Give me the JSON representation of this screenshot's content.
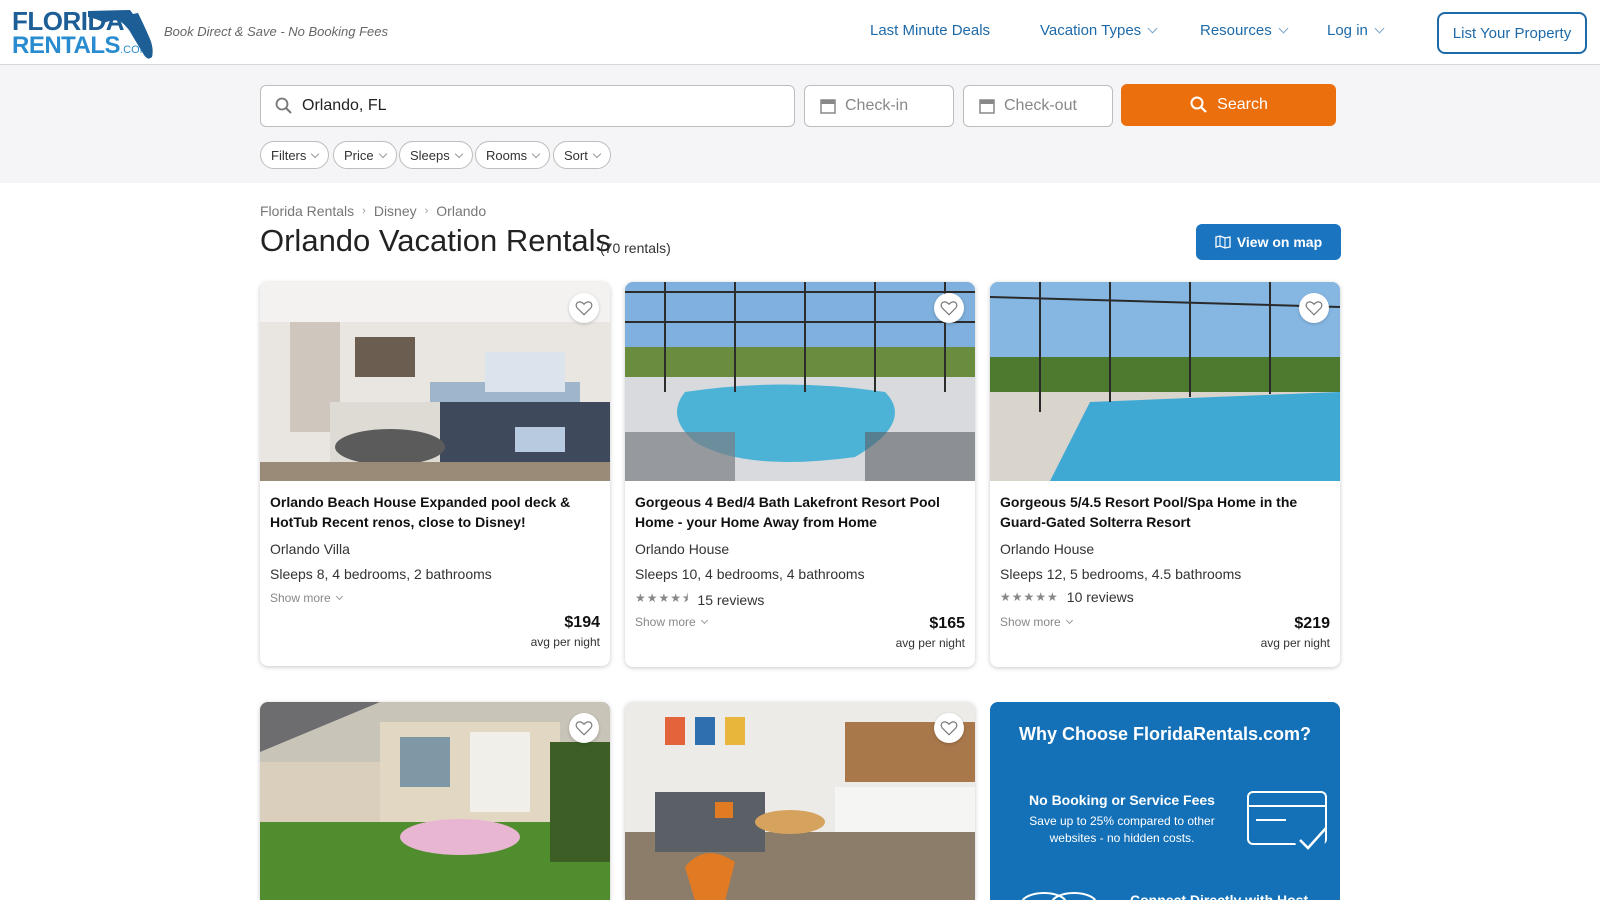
{
  "brand": {
    "logo_line1": "FLORIDA",
    "logo_line2": "RENTALS",
    "logo_tld": ".COM",
    "tagline": "Book Direct & Save - No Booking Fees",
    "primary_color": "#1e6aa8",
    "accent_color": "#ec6f0e"
  },
  "nav": {
    "last_minute": "Last Minute Deals",
    "vacation_types": "Vacation Types",
    "resources": "Resources",
    "login": "Log in",
    "list_property": "List Your Property"
  },
  "search": {
    "location_value": "Orlando, FL",
    "checkin_placeholder": "Check-in",
    "checkout_placeholder": "Check-out",
    "button_label": "Search"
  },
  "filters": [
    "Filters",
    "Price",
    "Sleeps",
    "Rooms",
    "Sort"
  ],
  "breadcrumb": [
    "Florida Rentals",
    "Disney",
    "Orlando"
  ],
  "page": {
    "title": "Orlando Vacation Rentals",
    "count": "(70 rentals)",
    "map_button": "View on map"
  },
  "listings": [
    {
      "title": "Orlando Beach House  Expanded pool deck & HotTub Recent renos, close to Disney!",
      "type": "Orlando Villa",
      "sleeps": "Sleeps 8, 4 bedrooms, 2 bathrooms",
      "rating": null,
      "reviews": "",
      "show_more": "Show more",
      "price": "$194",
      "price_note": "avg per night",
      "photo": "living-room"
    },
    {
      "title": "Gorgeous 4 Bed/4 Bath Lakefront Resort Pool Home - your Home Away from Home",
      "type": "Orlando House",
      "sleeps": "Sleeps 10, 4 bedrooms, 4 bathrooms",
      "rating": 4.5,
      "reviews": "15 reviews",
      "show_more": "Show more",
      "price": "$165",
      "price_note": "avg per night",
      "photo": "screened-pool"
    },
    {
      "title": "Gorgeous 5/4.5 Resort Pool/Spa Home in the Guard-Gated Solterra Resort",
      "type": "Orlando House",
      "sleeps": "Sleeps 12, 5 bedrooms, 4.5 bathrooms",
      "rating": 5,
      "reviews": "10 reviews",
      "show_more": "Show more",
      "price": "$219",
      "price_note": "avg per night",
      "photo": "pool-lanai"
    },
    {
      "photo": "house-exterior"
    },
    {
      "photo": "open-living-room"
    }
  ],
  "why": {
    "title": "Why Choose FloridaRentals.com?",
    "feature1_title": "No Booking or Service Fees",
    "feature1_desc": "Save up to 25% compared to other websites - no hidden costs.",
    "feature2_title": "Connect Directly with Host"
  }
}
